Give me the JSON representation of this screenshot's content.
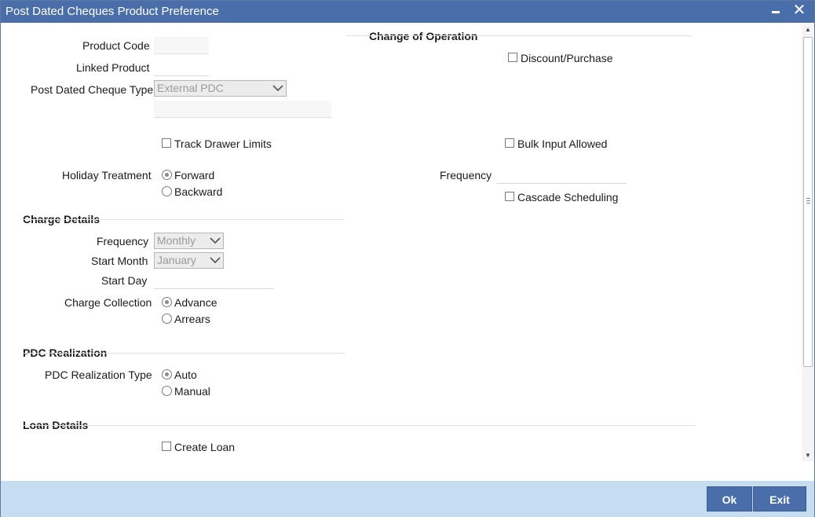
{
  "window": {
    "title": "Post Dated Cheques Product Preference",
    "minimize_icon": "minimize-icon",
    "close_symbol": "✕"
  },
  "left": {
    "product_code_label": "Product Code",
    "product_code_value": "",
    "linked_product_label": "Linked Product",
    "linked_product_value": "",
    "pdc_type_label": "Post Dated Cheque Type",
    "pdc_type_value": "External PDC",
    "pdc_type_desc": "",
    "track_drawer_limits_label": "Track Drawer Limits",
    "holiday_treatment_label": "Holiday Treatment",
    "holiday_forward_label": "Forward",
    "holiday_backward_label": "Backward"
  },
  "change_of_operation": {
    "heading": "Change of Operation",
    "discount_purchase_label": "Discount/Purchase",
    "bulk_input_label": "Bulk Input Allowed",
    "frequency_label": "Frequency",
    "frequency_value": "",
    "cascade_label": "Cascade Scheduling"
  },
  "charge_details": {
    "heading": "Charge Details",
    "frequency_label": "Frequency",
    "frequency_value": "Monthly",
    "start_month_label": "Start Month",
    "start_month_value": "January",
    "start_day_label": "Start Day",
    "start_day_value": "",
    "collection_label": "Charge Collection",
    "advance_label": "Advance",
    "arrears_label": "Arrears"
  },
  "pdc_realization": {
    "heading": "PDC Realization",
    "type_label": "PDC Realization Type",
    "auto_label": "Auto",
    "manual_label": "Manual"
  },
  "loan_details": {
    "heading": "Loan Details",
    "create_loan_label": "Create Loan"
  },
  "footer": {
    "ok_label": "Ok",
    "exit_label": "Exit"
  },
  "colors": {
    "titlebar": "#4a6ea9",
    "footer": "#c6dcef",
    "button": "#4a6ea9"
  }
}
